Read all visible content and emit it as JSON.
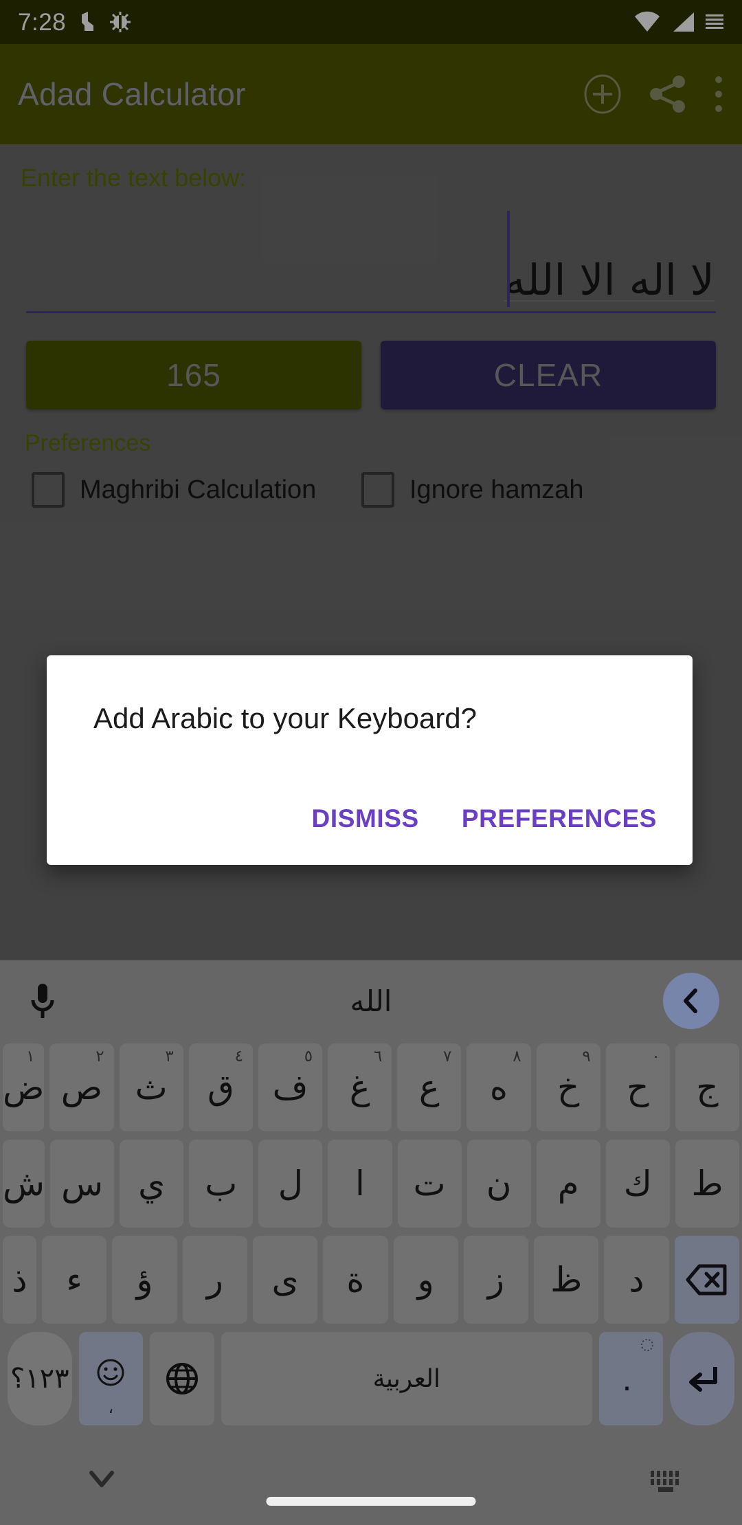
{
  "status_bar": {
    "time": "7:28",
    "icons": [
      "do-not-disturb-icon",
      "bug-icon",
      "wifi-icon",
      "signal-icon",
      "battery-icon"
    ],
    "background_color": "#2e3500"
  },
  "app_bar": {
    "title": "Adad Calculator",
    "background_color": "#4c5500",
    "title_color": "#9c9cad",
    "actions": [
      "add-circle-icon",
      "share-icon",
      "overflow-menu-icon"
    ]
  },
  "main": {
    "input_label": "Enter the text below:",
    "input_value": "لا اله الا الله",
    "input_underline_color": "#4a3d8f",
    "calculate_button_label": "165",
    "calculate_button_color": "#4a5300",
    "clear_button_label": "CLEAR",
    "clear_button_color": "#332a5c",
    "preferences_title": "Preferences",
    "preferences": [
      {
        "label": "Maghribi Calculation",
        "checked": false
      },
      {
        "label": "Ignore hamzah",
        "checked": false
      }
    ],
    "label_color": "#5d6a00"
  },
  "dialog": {
    "title": "Add Arabic to your Keyboard?",
    "dismiss_label": "DISMISS",
    "preferences_label": "PREFERENCES",
    "action_color": "#6a3fc4",
    "background_color": "#ffffff"
  },
  "keyboard": {
    "suggestion": "الله",
    "mic_icon": "microphone-icon",
    "nav_icon": "chevron-left-icon",
    "accent_color": "#7885aa",
    "background_color": "#666666",
    "row1": [
      {
        "char": "ض",
        "sup": "١"
      },
      {
        "char": "ص",
        "sup": "٢"
      },
      {
        "char": "ث",
        "sup": "٣"
      },
      {
        "char": "ق",
        "sup": "٤"
      },
      {
        "char": "ف",
        "sup": "٥"
      },
      {
        "char": "غ",
        "sup": "٦"
      },
      {
        "char": "ع",
        "sup": "٧"
      },
      {
        "char": "ه",
        "sup": "٨"
      },
      {
        "char": "خ",
        "sup": "٩"
      },
      {
        "char": "ح",
        "sup": "٠"
      },
      {
        "char": "ج",
        "sup": ""
      }
    ],
    "row2": [
      {
        "char": "ش"
      },
      {
        "char": "س"
      },
      {
        "char": "ي"
      },
      {
        "char": "ب"
      },
      {
        "char": "ل"
      },
      {
        "char": "ا"
      },
      {
        "char": "ت"
      },
      {
        "char": "ن"
      },
      {
        "char": "م"
      },
      {
        "char": "ك"
      },
      {
        "char": "ط"
      }
    ],
    "row3": [
      {
        "char": "ذ"
      },
      {
        "char": "ء"
      },
      {
        "char": "ؤ"
      },
      {
        "char": "ر"
      },
      {
        "char": "ى"
      },
      {
        "char": "ة"
      },
      {
        "char": "و"
      },
      {
        "char": "ز"
      },
      {
        "char": "ظ"
      },
      {
        "char": "د"
      }
    ],
    "backspace_icon": "backspace-icon",
    "row4": {
      "symbols_label": "١٢٣؟",
      "emoji_icon": "emoji-icon",
      "emoji_sub": "،",
      "globe_icon": "globe-icon",
      "space_label": "العربية",
      "period_label": ".",
      "enter_icon": "enter-icon"
    }
  },
  "nav_bar": {
    "hide_keyboard_icon": "chevron-down-icon",
    "keyboard_switch_icon": "keyboard-icon",
    "home_indicator": "home-pill"
  }
}
